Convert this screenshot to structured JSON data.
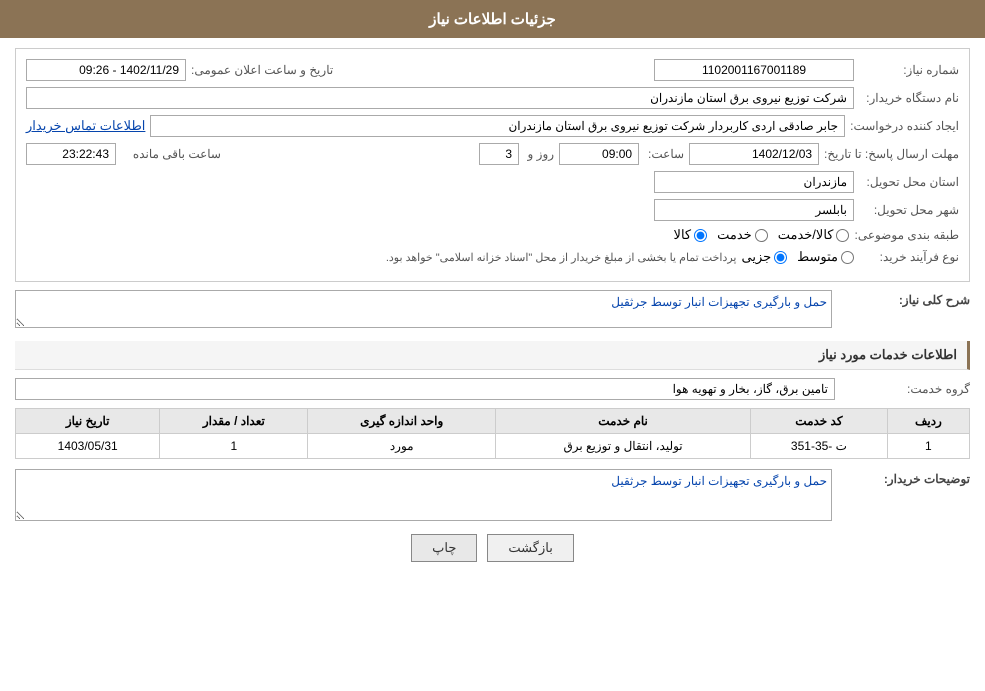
{
  "header": {
    "title": "جزئیات اطلاعات نیاز"
  },
  "fields": {
    "need_number_label": "شماره نیاز:",
    "need_number_value": "1102001167001189",
    "announcement_datetime_label": "تاریخ و ساعت اعلان عمومی:",
    "announcement_datetime_value": "1402/11/29 - 09:26",
    "buyer_org_label": "نام دستگاه خریدار:",
    "buyer_org_value": "شرکت توزیع نیروی برق استان مازندران",
    "requester_label": "ایجاد کننده درخواست:",
    "requester_value": "جابر صادقی اردی کاربردار شرکت توزیع نیروی برق استان مازندران",
    "contact_link": "اطلاعات تماس خریدار",
    "response_deadline_label": "مهلت ارسال پاسخ: تا تاریخ:",
    "response_date": "1402/12/03",
    "response_time_label": "ساعت:",
    "response_time": "09:00",
    "response_day_label": "روز و",
    "response_day": "3",
    "response_remaining_label": "ساعت باقی مانده",
    "response_remaining_time": "23:22:43",
    "delivery_province_label": "استان محل تحویل:",
    "delivery_province": "مازندران",
    "delivery_city_label": "شهر محل تحویل:",
    "delivery_city": "بابلسر",
    "classification_label": "طبقه بندی موضوعی:",
    "classification_options": [
      "کالا",
      "خدمت",
      "کالا/خدمت"
    ],
    "classification_selected": "کالا",
    "purchase_type_label": "نوع فرآیند خرید:",
    "purchase_types": [
      "جزیی",
      "متوسط"
    ],
    "purchase_note": "پرداخت تمام یا بخشی از مبلغ خریدار از محل \"اسناد خزانه اسلامی\" خواهد بود.",
    "general_description_label": "شرح کلی نیاز:",
    "general_description_value": "حمل و بارگیری تجهیزات انبار توسط جرثقیل",
    "services_section_label": "اطلاعات خدمات مورد نیاز",
    "service_group_label": "گروه خدمت:",
    "service_group_value": "تامین برق، گاز، بخار و تهویه هوا",
    "table": {
      "columns": [
        "ردیف",
        "کد خدمت",
        "نام خدمت",
        "واحد اندازه گیری",
        "تعداد / مقدار",
        "تاریخ نیاز"
      ],
      "rows": [
        {
          "row_num": "1",
          "service_code": "ت -35-351",
          "service_name": "تولید، انتقال و توزیع برق",
          "unit": "مورد",
          "quantity": "1",
          "date": "1403/05/31"
        }
      ]
    },
    "buyer_description_label": "توضیحات خریدار:",
    "buyer_description_value": "حمل و بارگیری تجهیزات انبار توسط جرثقیل"
  },
  "buttons": {
    "print_label": "چاپ",
    "back_label": "بازگشت"
  }
}
